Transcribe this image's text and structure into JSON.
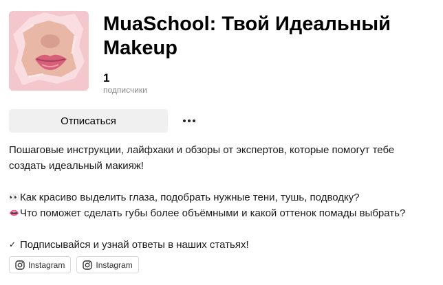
{
  "channel": {
    "title": "MuaSchool: Твой Идеальный Makeup",
    "subscribers_count": "1",
    "subscribers_label": "подписчики"
  },
  "actions": {
    "unsubscribe_label": "Отписаться",
    "more_icon": "more-horizontal-icon"
  },
  "description": {
    "intro": "Пошаговые инструкции, лайфхаки и обзоры от экспертов, которые помогут тебе создать идеальный макияж!",
    "line1_icon": "👀",
    "line1": "Как красиво выделить глаза, подобрать нужные тени, тушь, подводку?",
    "line2_icon": "👄",
    "line2": "Что поможет сделать губы более объёмными и какой оттенок помады выбрать?",
    "line3_icon": "✓",
    "line3": "Подписывайся и узнай ответы в наших статьях!"
  },
  "links": [
    {
      "label": "Instagram",
      "icon": "instagram-icon"
    },
    {
      "label": "Instagram",
      "icon": "instagram-icon"
    }
  ],
  "colors": {
    "button_bg": "#f0f0f0",
    "avatar_bg": "#f3c7cc",
    "muted_text": "#8a8a8a"
  }
}
